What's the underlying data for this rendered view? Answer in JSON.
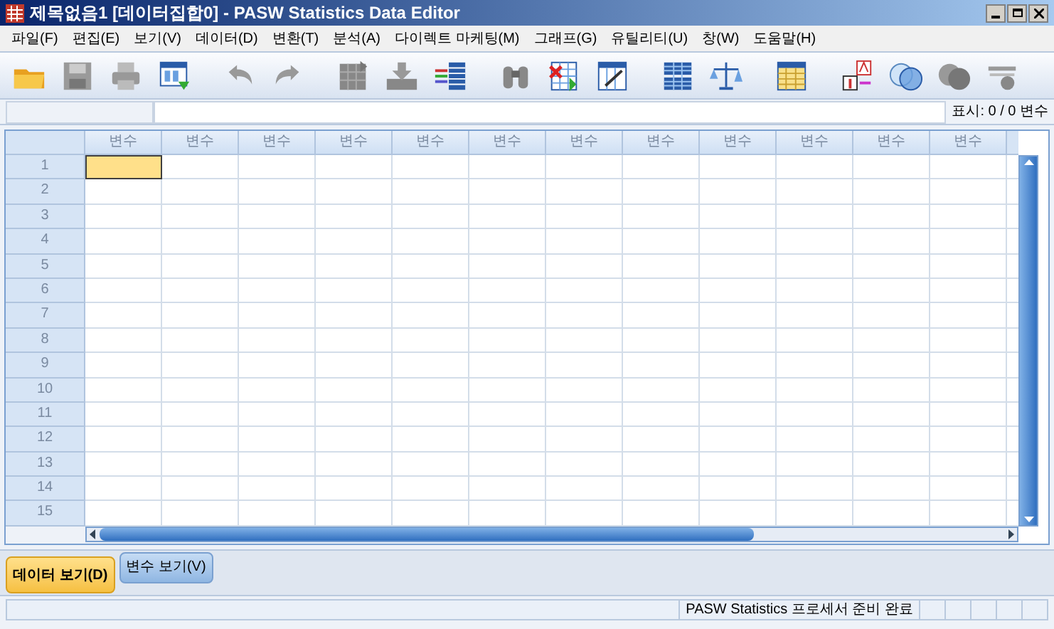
{
  "window": {
    "title": "제목없음1 [데이터집합0] - PASW Statistics Data Editor"
  },
  "menu": [
    "파일(F)",
    "편집(E)",
    "보기(V)",
    "데이터(D)",
    "변환(T)",
    "분석(A)",
    "다이렉트 마케팅(M)",
    "그래프(G)",
    "유틸리티(U)",
    "창(W)",
    "도움말(H)"
  ],
  "cell_editor": {
    "display": "표시: 0 / 0 변수"
  },
  "grid": {
    "columns": [
      "변수",
      "변수",
      "변수",
      "변수",
      "변수",
      "변수",
      "변수",
      "변수",
      "변수",
      "변수",
      "변수",
      "변수"
    ],
    "rows": [
      {
        "label": "1",
        "selected": true
      },
      {
        "label": "2",
        "selected": false
      },
      {
        "label": "3",
        "selected": false
      },
      {
        "label": "4",
        "selected": false
      },
      {
        "label": "5",
        "selected": false
      },
      {
        "label": "6",
        "selected": false
      },
      {
        "label": "7",
        "selected": false
      },
      {
        "label": "8",
        "selected": false
      },
      {
        "label": "9",
        "selected": false
      },
      {
        "label": "10",
        "selected": false
      },
      {
        "label": "11",
        "selected": false
      },
      {
        "label": "12",
        "selected": false
      },
      {
        "label": "13",
        "selected": false
      },
      {
        "label": "14",
        "selected": false
      },
      {
        "label": "15",
        "selected": false
      }
    ]
  },
  "tabs": [
    {
      "label": "데이터 보기(D)",
      "selected": true
    },
    {
      "label": "변수 보기(V)",
      "selected": false
    }
  ],
  "status_bar": "PASW Statistics 프로세서 준비 완료"
}
